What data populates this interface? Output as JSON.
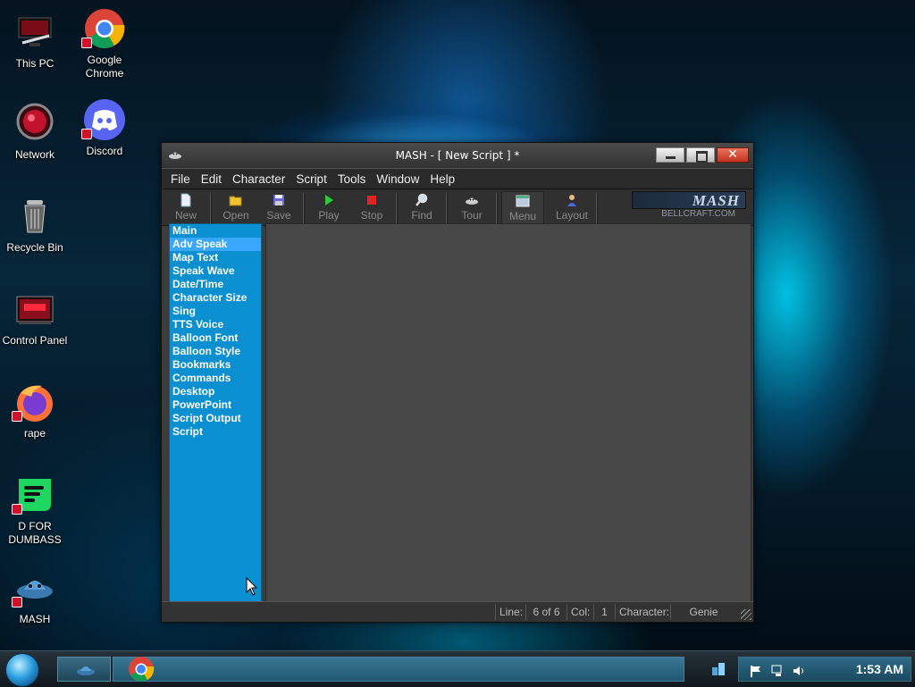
{
  "desktop": {
    "icons": [
      {
        "label": "This PC"
      },
      {
        "label": "Google Chrome"
      },
      {
        "label": "Network"
      },
      {
        "label": "Discord"
      },
      {
        "label": "Recycle Bin"
      },
      {
        "label": "Control Panel"
      },
      {
        "label": "rape"
      },
      {
        "label": "D FOR DUMBASS"
      },
      {
        "label": "MASH"
      }
    ]
  },
  "window": {
    "title": "MASH - [ New Script ] *",
    "menu": [
      "File",
      "Edit",
      "Character",
      "Script",
      "Tools",
      "Window",
      "Help"
    ],
    "toolbar": {
      "buttons": [
        "New",
        "Open",
        "Save",
        "Play",
        "Stop",
        "Find",
        "Tour",
        "Menu",
        "Layout"
      ],
      "brand_logo": "MASH",
      "brand_sub": "BELLCRAFT.COM"
    },
    "sidebar": {
      "items": [
        "Main",
        "Adv Speak",
        "Map Text",
        "Speak Wave",
        "Date/Time",
        "Character Size",
        "Sing",
        "TTS Voice",
        "Balloon Font",
        "Balloon Style",
        "Bookmarks",
        "Commands",
        "Desktop",
        "PowerPoint",
        "Script Output",
        "Script"
      ],
      "selected": "Adv Speak"
    },
    "status": {
      "line_label": "Line:",
      "line_value": "6 of 6",
      "col_label": "Col:",
      "col_value": "1",
      "char_label": "Character:",
      "char_value": "Genie"
    }
  },
  "taskbar": {
    "clock": "1:53 AM"
  },
  "colors": {
    "sidebar_bg": "#0a8fd0",
    "sidebar_selected": "#3aa7ff",
    "window_bg": "#3c3c3c",
    "content_bg": "#484848"
  }
}
